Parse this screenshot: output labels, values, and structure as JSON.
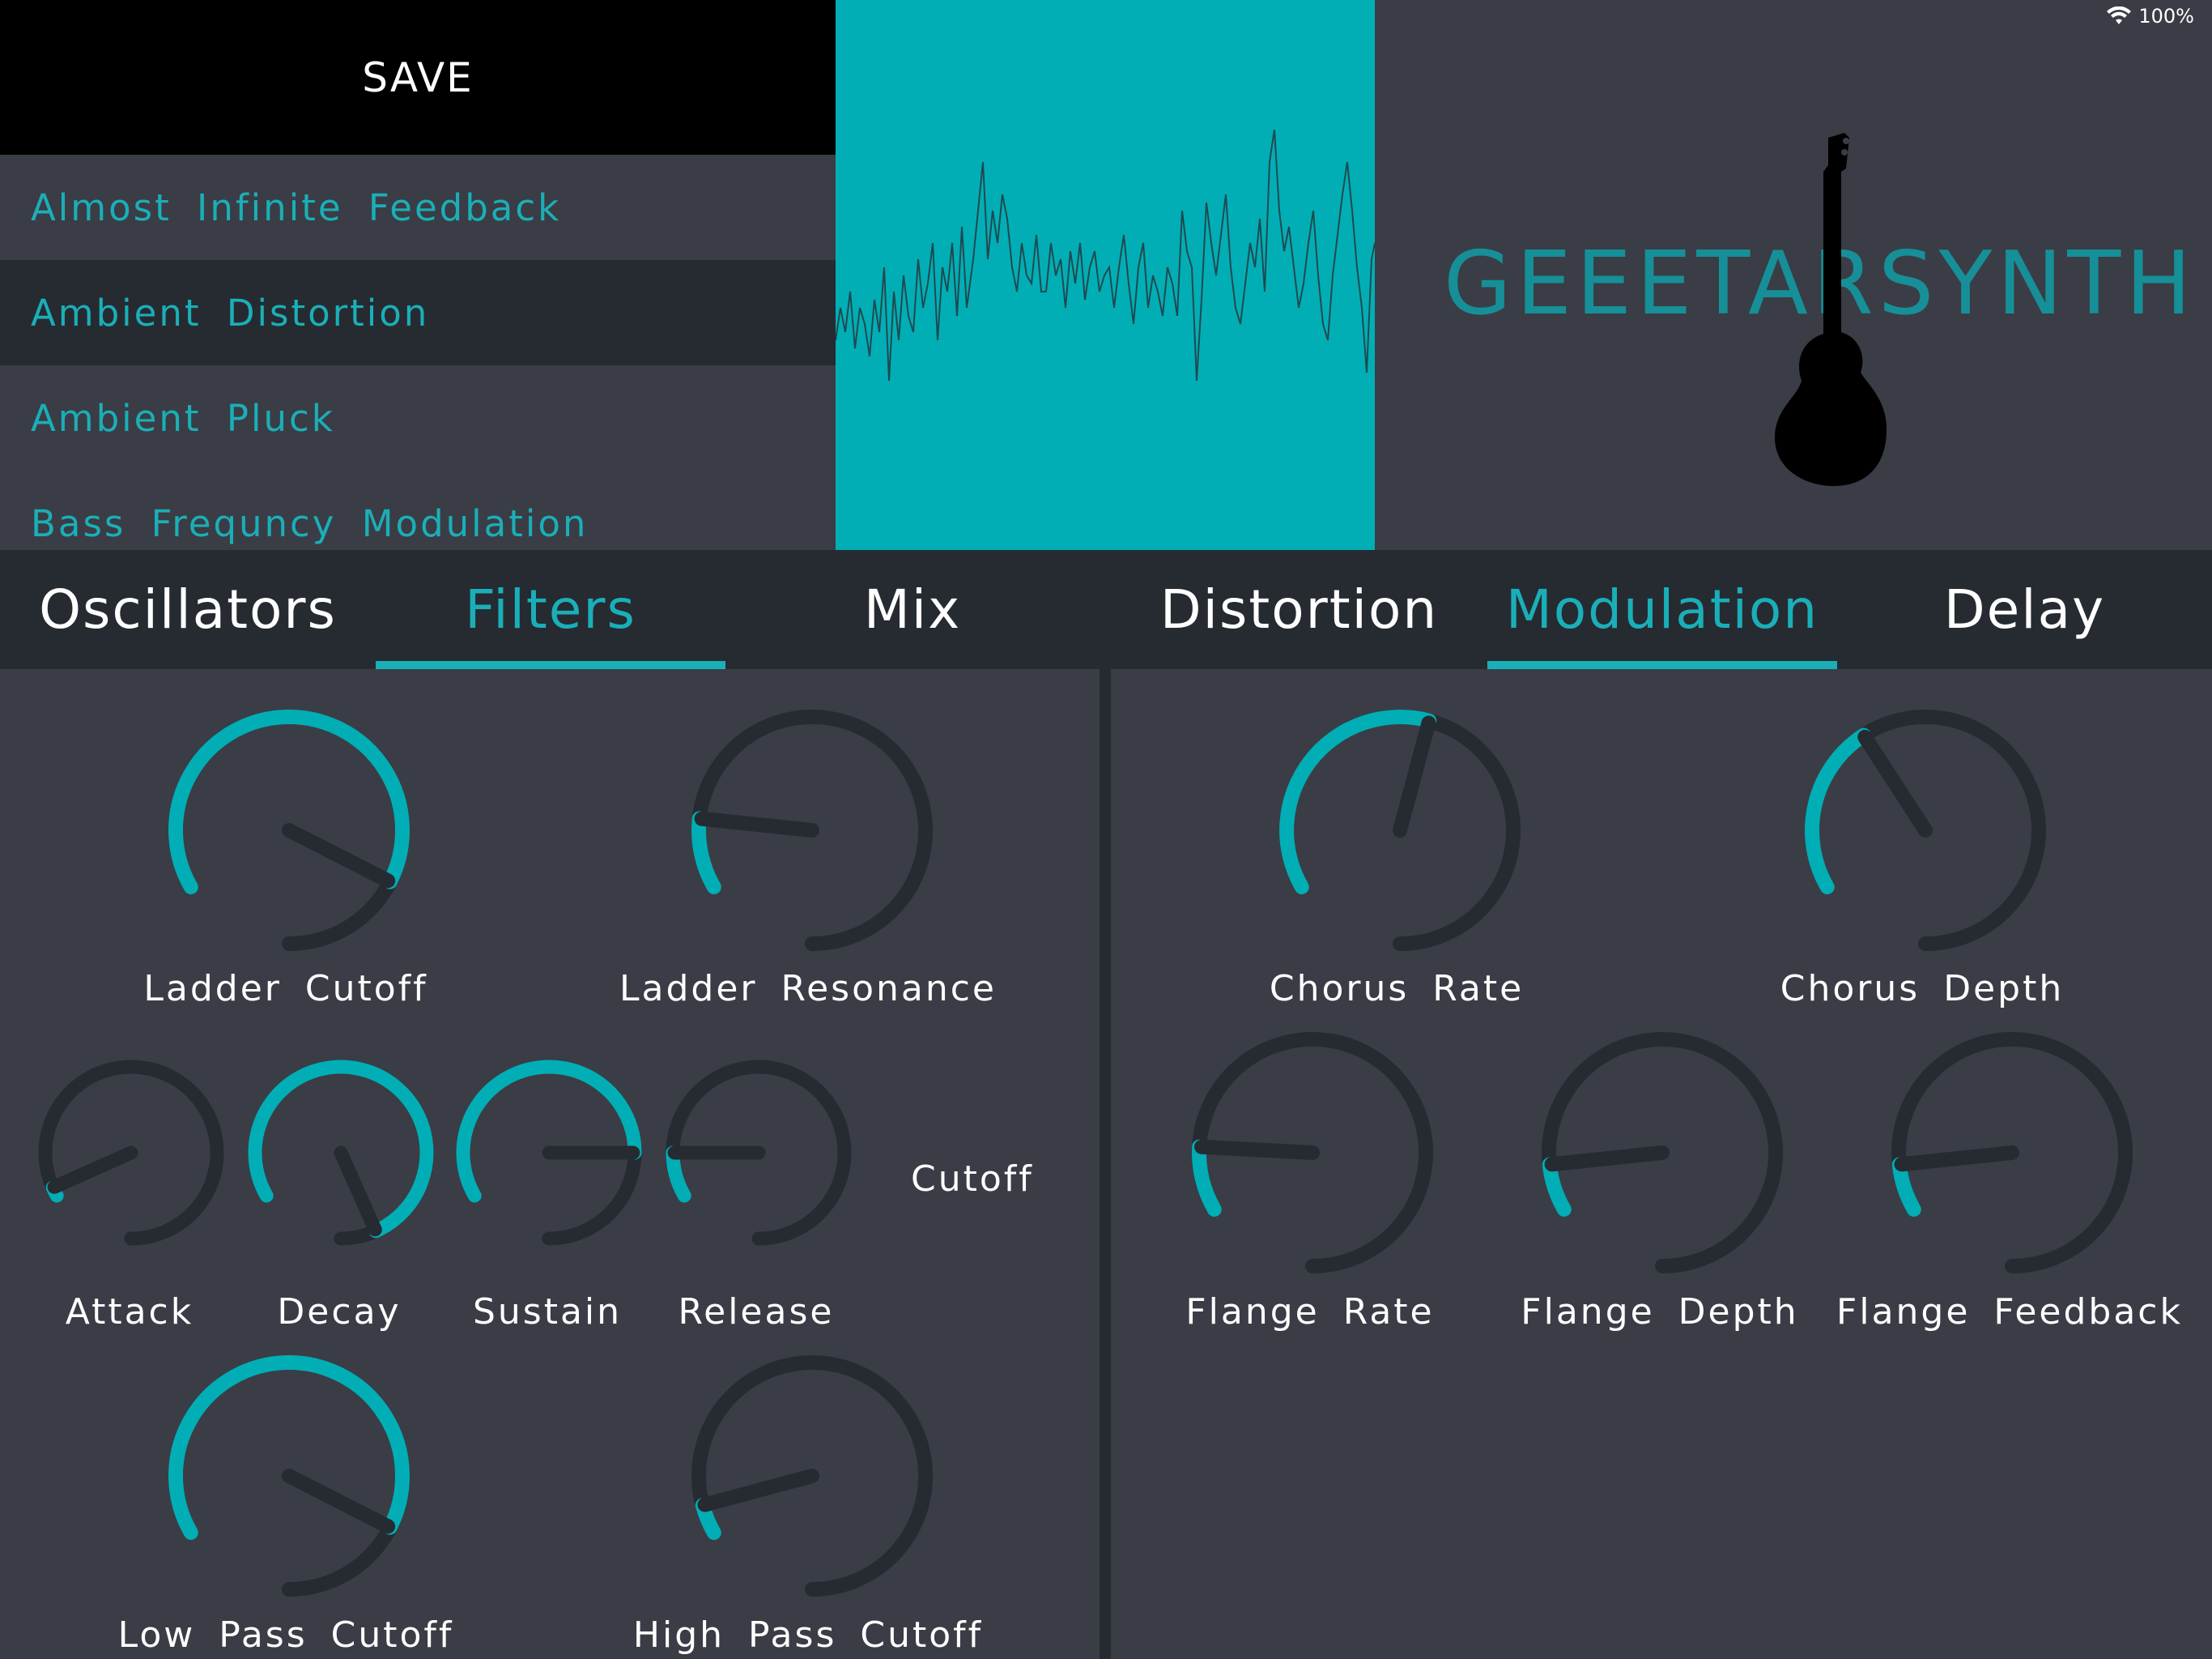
{
  "status": {
    "battery": "100%"
  },
  "save_label": "SAVE",
  "presets": [
    {
      "label": "Almost Infinite Feedback",
      "selected": false
    },
    {
      "label": "Ambient Distortion",
      "selected": true
    },
    {
      "label": "Ambient Pluck",
      "selected": false
    },
    {
      "label": "Bass Frequncy Modulation",
      "selected": false
    }
  ],
  "logo": {
    "left": "GEEETAR",
    "right": "SYNTH"
  },
  "tabs_left": [
    {
      "label": "Oscillators",
      "active": false
    },
    {
      "label": "Filters",
      "active": true
    },
    {
      "label": "Mix",
      "active": false
    }
  ],
  "tabs_right": [
    {
      "label": "Distortion",
      "active": false
    },
    {
      "label": "Modulation",
      "active": true
    },
    {
      "label": "Delay",
      "active": false
    }
  ],
  "filters": {
    "ladder_cutoff": {
      "label": "Ladder Cutoff",
      "value": 0.79
    },
    "ladder_resonance": {
      "label": "Ladder Resonance",
      "value": 0.12
    },
    "attack": {
      "label": "Attack",
      "value": 0.02
    },
    "decay": {
      "label": "Decay",
      "value": 0.92
    },
    "sustain": {
      "label": "Sustain",
      "value": 0.7
    },
    "release": {
      "label": "Release",
      "value": 0.1
    },
    "cutoff_text": "Cutoff",
    "low_pass_cutoff": {
      "label": "Low Pass Cutoff",
      "value": 0.79
    },
    "high_pass_cutoff": {
      "label": "High Pass Cutoff",
      "value": 0.05
    }
  },
  "modulation": {
    "chorus_rate": {
      "label": "Chorus Rate",
      "value": 0.45
    },
    "chorus_depth": {
      "label": "Chorus Depth",
      "value": 0.29
    },
    "flange_rate": {
      "label": "Flange Rate",
      "value": 0.11
    },
    "flange_depth": {
      "label": "Flange Depth",
      "value": 0.08
    },
    "flange_feedback": {
      "label": "Flange Feedback",
      "value": 0.08
    }
  },
  "colors": {
    "accent": "#02aeb5",
    "track": "#262b31",
    "background": "#3a3d45",
    "logo": "#168f98"
  }
}
